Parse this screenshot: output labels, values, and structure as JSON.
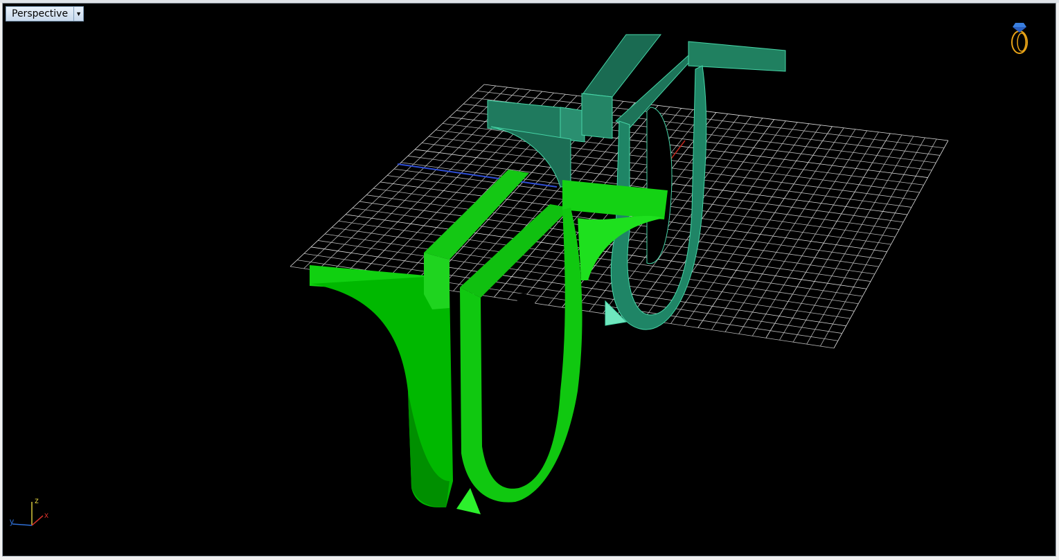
{
  "viewport": {
    "name": "Perspective",
    "menu_icon": "chevron-down-icon"
  },
  "axis_widget": {
    "x_label": "x",
    "y_label": "y",
    "z_label": "z",
    "x_color": "#d0302a",
    "y_color": "#2f6fd6",
    "z_color": "#d7c93c"
  },
  "colors": {
    "background": "#000000",
    "grid": "#bfbfbf",
    "selected_shape": "#00c800",
    "shape_teal": "#1f7f62"
  },
  "nav_icon": "ring-navigator-icon"
}
